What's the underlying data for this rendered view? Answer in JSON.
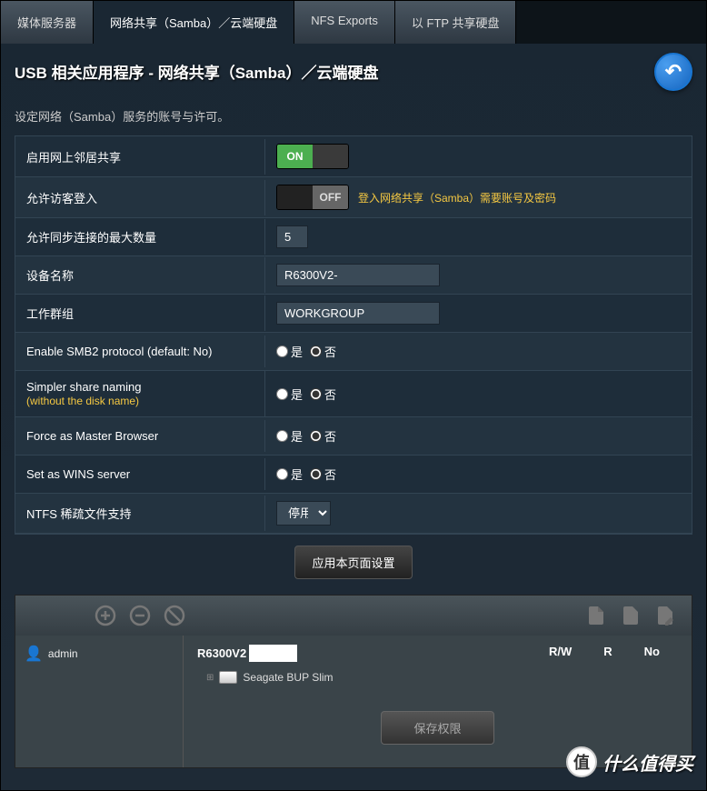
{
  "tabs": {
    "t0": "媒体服务器",
    "t1": "网络共享（Samba）／云端硬盘",
    "t2": "NFS Exports",
    "t3": "以 FTP 共享硬盘"
  },
  "header": {
    "title": "USB 相关应用程序 - 网络共享（Samba）／云端硬盘",
    "subtitle": "设定网络（Samba）服务的账号与许可。"
  },
  "settings": {
    "enable_share": {
      "label": "启用网上邻居共享",
      "toggle": "ON"
    },
    "guest_login": {
      "label": "允许访客登入",
      "toggle": "OFF",
      "info": "登入网络共享（Samba）需要账号及密码"
    },
    "max_conn": {
      "label": "允许同步连接的最大数量",
      "value": "5"
    },
    "device_name": {
      "label": "设备名称",
      "value": "R6300V2-"
    },
    "workgroup": {
      "label": "工作群组",
      "value": "WORKGROUP"
    },
    "smb2": {
      "label": "Enable SMB2 protocol (default: No)",
      "yes": "是",
      "no": "否"
    },
    "simple_name": {
      "label": "Simpler share naming",
      "sub": "(without the disk name)",
      "yes": "是",
      "no": "否"
    },
    "master_browser": {
      "label": "Force as Master Browser",
      "yes": "是",
      "no": "否"
    },
    "wins": {
      "label": "Set as WINS server",
      "yes": "是",
      "no": "否"
    },
    "ntfs": {
      "label": "NTFS 稀疏文件支持",
      "value": "停用"
    }
  },
  "apply_button": "应用本页面设置",
  "share": {
    "user": "admin",
    "device": "R6300V2",
    "perm_rw": "R/W",
    "perm_r": "R",
    "perm_no": "No",
    "disk": "Seagate BUP Slim",
    "save_btn": "保存权限"
  },
  "watermark": {
    "circle": "值",
    "text": "什么值得买"
  }
}
